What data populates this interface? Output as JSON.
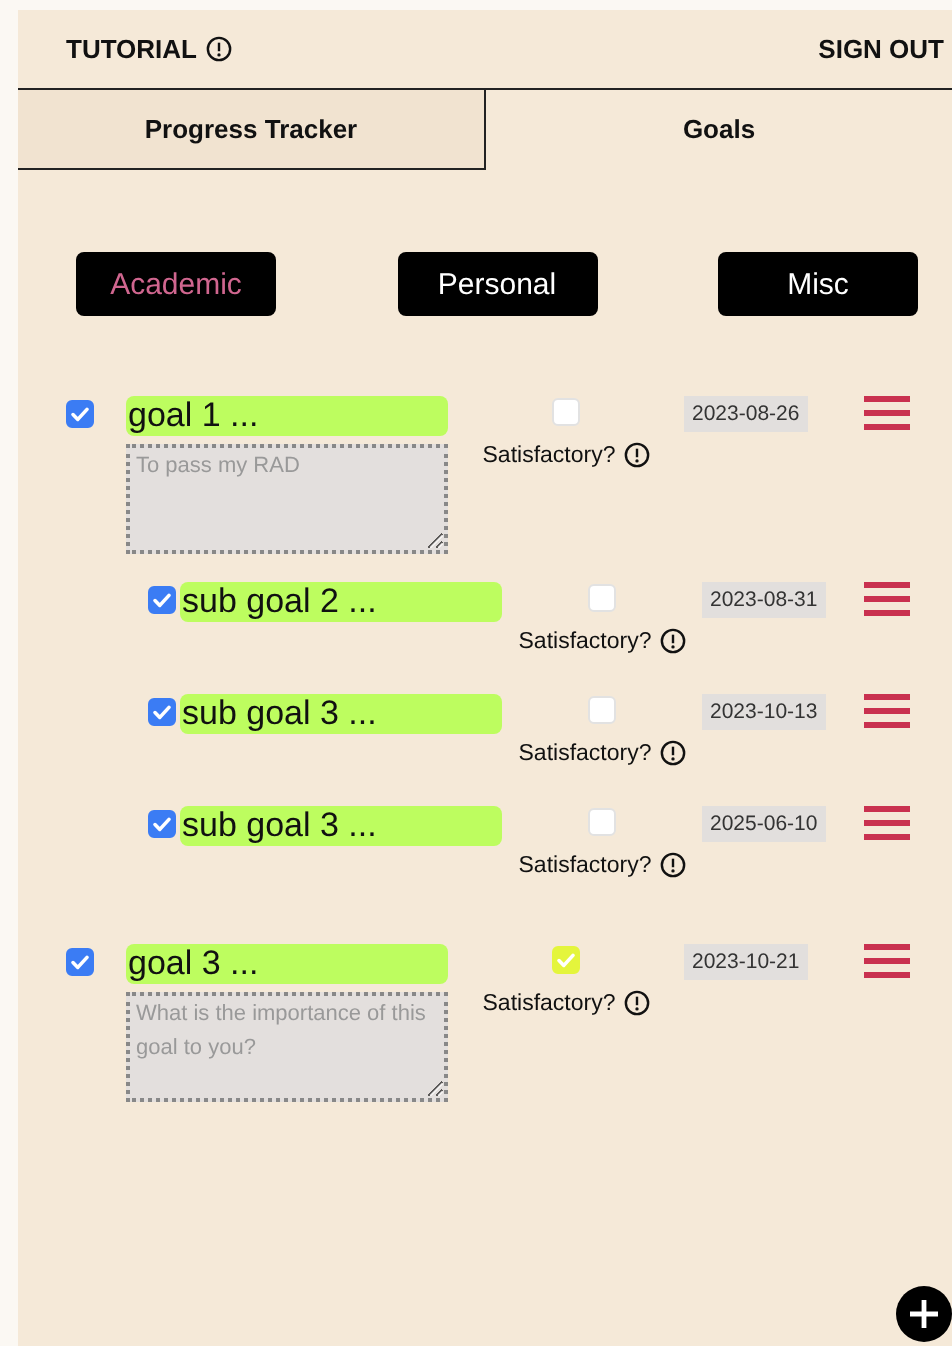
{
  "header": {
    "tutorial": "TUTORIAL",
    "sign_out": "SIGN OUT"
  },
  "tabs": [
    {
      "label": "Progress Tracker",
      "selected": false
    },
    {
      "label": "Goals",
      "selected": true
    }
  ],
  "categories": [
    {
      "label": "Academic",
      "selected": true
    },
    {
      "label": "Personal",
      "selected": false
    },
    {
      "label": "Misc",
      "selected": false
    }
  ],
  "goals": [
    {
      "done": true,
      "name": "goal 1 ...",
      "satisfactory": false,
      "satisfactory_label": "Satisfactory?",
      "date": "2023-08-26",
      "note_placeholder": "To pass my RAD",
      "children": [
        {
          "done": true,
          "name": "sub goal 2 ...",
          "satisfactory": false,
          "satisfactory_label": "Satisfactory?",
          "date": "2023-08-31"
        },
        {
          "done": true,
          "name": "sub goal 3 ...",
          "satisfactory": false,
          "satisfactory_label": "Satisfactory?",
          "date": "2023-10-13"
        },
        {
          "done": true,
          "name": "sub goal 3 ...",
          "satisfactory": false,
          "satisfactory_label": "Satisfactory?",
          "date": "2025-06-10"
        }
      ]
    },
    {
      "done": true,
      "name": "goal 3 ...",
      "satisfactory": true,
      "satisfactory_label": "Satisfactory?",
      "date": "2023-10-21",
      "note_placeholder": "What is the importance of this goal to you?"
    }
  ]
}
